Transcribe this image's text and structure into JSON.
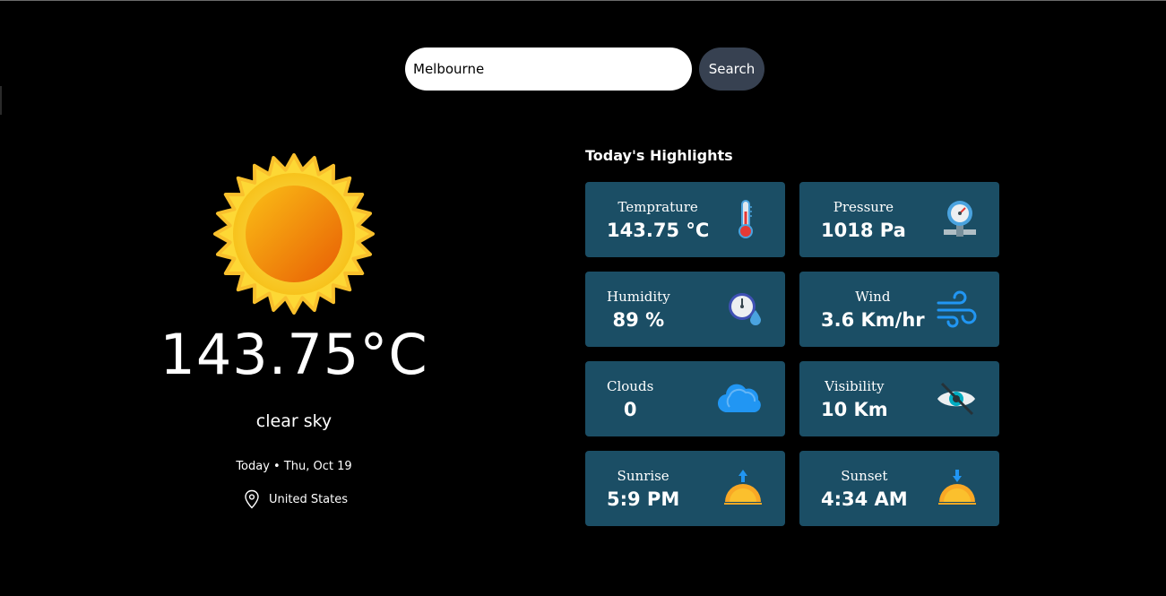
{
  "search": {
    "value": "Melbourne",
    "button_label": "Search"
  },
  "current": {
    "icon": "sun-icon",
    "temperature": "143.75°C",
    "condition": "clear sky",
    "date": "Today • Thu, Oct 19",
    "location": "United States"
  },
  "highlights": {
    "title": "Today's Highlights",
    "cards": [
      {
        "label": "Temprature",
        "value": "143.75 °C",
        "icon": "thermometer-icon"
      },
      {
        "label": "Pressure",
        "value": "1018 Pa",
        "icon": "pressure-gauge-icon"
      },
      {
        "label": "Humidity",
        "value": "89 %",
        "icon": "humidity-icon"
      },
      {
        "label": "Wind",
        "value": "3.6 Km/hr",
        "icon": "wind-icon"
      },
      {
        "label": "Clouds",
        "value": "0",
        "icon": "cloud-icon"
      },
      {
        "label": "Visibility",
        "value": "10 Km",
        "icon": "visibility-eye-icon"
      },
      {
        "label": "Sunrise",
        "value": "5:9 PM",
        "icon": "sunrise-icon"
      },
      {
        "label": "Sunset",
        "value": "4:34 AM",
        "icon": "sunset-icon"
      }
    ]
  },
  "colors": {
    "background": "#000000",
    "card": "#1b4e65",
    "search_button": "#374151"
  }
}
